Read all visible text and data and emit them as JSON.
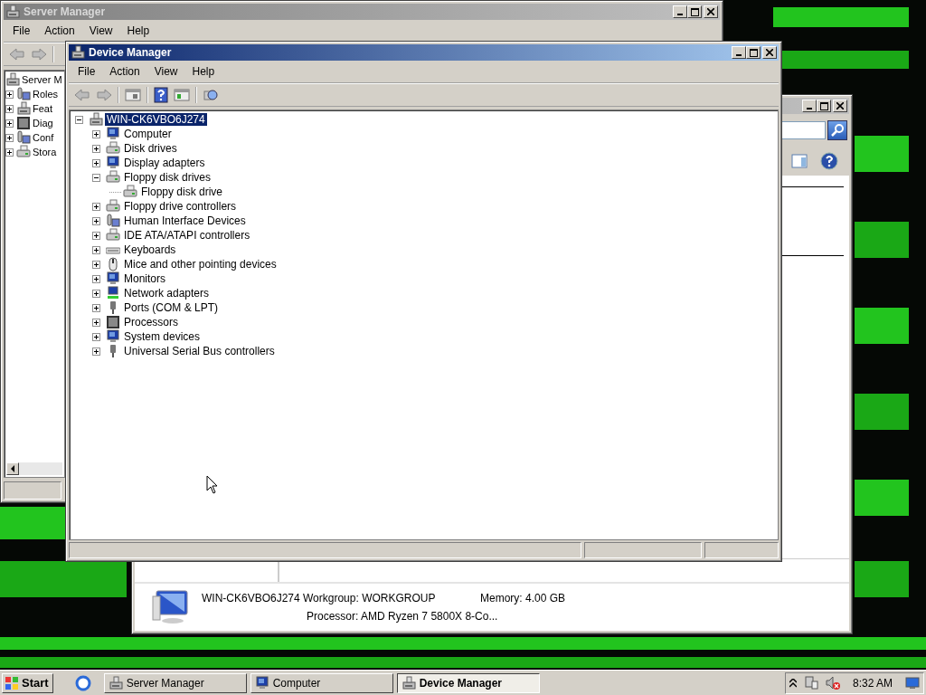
{
  "server_manager": {
    "title": "Server Manager",
    "menu": [
      "File",
      "Action",
      "View",
      "Help"
    ],
    "tree": [
      {
        "label": "Server M",
        "children": [
          {
            "label": "Roles",
            "expanded": false
          },
          {
            "label": "Feat",
            "expanded": false
          },
          {
            "label": "Diag",
            "expanded": false
          },
          {
            "label": "Conf",
            "expanded": false
          },
          {
            "label": "Stora",
            "expanded": false
          }
        ]
      }
    ]
  },
  "computer_window": {
    "details": {
      "name": "WIN-CK6VBO6J274",
      "workgroup": "Workgroup: WORKGROUP",
      "memory": "Memory: 4.00 GB",
      "processor": "Processor: AMD Ryzen 7 5800X 8-Co..."
    }
  },
  "device_manager": {
    "title": "Device Manager",
    "menu": [
      "File",
      "Action",
      "View",
      "Help"
    ],
    "tree": {
      "label": "WIN-CK6VBO6J274",
      "expanded": true,
      "selected": true,
      "children": [
        {
          "label": "Computer",
          "expanded": false,
          "selected": false
        },
        {
          "label": "Disk drives",
          "expanded": false,
          "selected": false
        },
        {
          "label": "Display adapters",
          "expanded": false,
          "selected": false
        },
        {
          "label": "Floppy disk drives",
          "expanded": true,
          "selected": false,
          "children": [
            {
              "label": "Floppy disk drive",
              "selected": false
            }
          ]
        },
        {
          "label": "Floppy drive controllers",
          "expanded": false,
          "selected": false
        },
        {
          "label": "Human Interface Devices",
          "expanded": false,
          "selected": false
        },
        {
          "label": "IDE ATA/ATAPI controllers",
          "expanded": false,
          "selected": false
        },
        {
          "label": "Keyboards",
          "expanded": false,
          "selected": false
        },
        {
          "label": "Mice and other pointing devices",
          "expanded": false,
          "selected": false
        },
        {
          "label": "Monitors",
          "expanded": false,
          "selected": false
        },
        {
          "label": "Network adapters",
          "expanded": false,
          "selected": false
        },
        {
          "label": "Ports (COM & LPT)",
          "expanded": false,
          "selected": false
        },
        {
          "label": "Processors",
          "expanded": false,
          "selected": false
        },
        {
          "label": "System devices",
          "expanded": false,
          "selected": false
        },
        {
          "label": "Universal Serial Bus controllers",
          "expanded": false,
          "selected": false
        }
      ]
    }
  },
  "taskbar": {
    "start": "Start",
    "tasks": [
      {
        "label": "Server Manager",
        "selected": false
      },
      {
        "label": "Computer",
        "selected": false
      },
      {
        "label": "Device Manager",
        "selected": true
      }
    ],
    "clock": "8:32 AM"
  }
}
